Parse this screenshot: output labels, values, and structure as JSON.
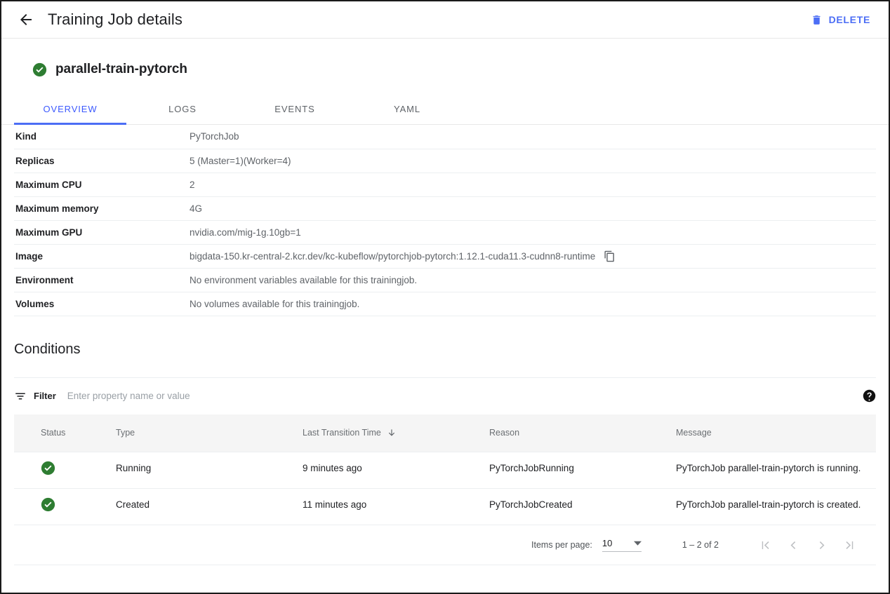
{
  "header": {
    "back_icon": "arrow-left-icon",
    "title": "Training Job details",
    "delete_label": "DELETE",
    "delete_icon": "trash-icon",
    "delete_color": "#4c6ef5"
  },
  "job": {
    "status_icon": "check-circle-icon",
    "status_color": "#2e7d32",
    "name": "parallel-train-pytorch"
  },
  "tabs": [
    {
      "label": "OVERVIEW",
      "active": true
    },
    {
      "label": "LOGS",
      "active": false
    },
    {
      "label": "EVENTS",
      "active": false
    },
    {
      "label": "YAML",
      "active": false
    }
  ],
  "details": [
    {
      "label": "Kind",
      "value": "PyTorchJob",
      "copy": false
    },
    {
      "label": "Replicas",
      "value": "5 (Master=1)(Worker=4)",
      "copy": false
    },
    {
      "label": "Maximum CPU",
      "value": "2",
      "copy": false
    },
    {
      "label": "Maximum memory",
      "value": "4G",
      "copy": false
    },
    {
      "label": "Maximum GPU",
      "value": "nvidia.com/mig-1g.10gb=1",
      "copy": false
    },
    {
      "label": "Image",
      "value": "bigdata-150.kr-central-2.kcr.dev/kc-kubeflow/pytorchjob-pytorch:1.12.1-cuda11.3-cudnn8-runtime",
      "copy": true
    },
    {
      "label": "Environment",
      "value": "No environment variables available for this trainingjob.",
      "copy": false
    },
    {
      "label": "Volumes",
      "value": "No volumes available for this trainingjob.",
      "copy": false
    }
  ],
  "conditions": {
    "title": "Conditions",
    "filter": {
      "icon": "filter-icon",
      "label": "Filter",
      "placeholder": "Enter property name or value",
      "value": "",
      "help_icon": "help-circle-icon"
    },
    "columns": [
      {
        "label": "Status",
        "sorted": false
      },
      {
        "label": "Type",
        "sorted": false
      },
      {
        "label": "Last Transition Time",
        "sorted": true,
        "sort_icon": "arrow-down-icon"
      },
      {
        "label": "Reason",
        "sorted": false
      },
      {
        "label": "Message",
        "sorted": false
      }
    ],
    "rows": [
      {
        "status_icon": "check-circle-icon",
        "type": "Running",
        "last_transition_time": "9 minutes ago",
        "reason": "PyTorchJobRunning",
        "message": "PyTorchJob parallel-train-pytorch is running."
      },
      {
        "status_icon": "check-circle-icon",
        "type": "Created",
        "last_transition_time": "11 minutes ago",
        "reason": "PyTorchJobCreated",
        "message": "PyTorchJob parallel-train-pytorch is created."
      }
    ],
    "paginator": {
      "items_per_page_label": "Items per page:",
      "items_per_page_value": "10",
      "range_label": "1 – 2 of 2",
      "first_icon": "first-page-icon",
      "prev_icon": "chevron-left-icon",
      "next_icon": "chevron-right-icon",
      "last_icon": "last-page-icon"
    }
  }
}
